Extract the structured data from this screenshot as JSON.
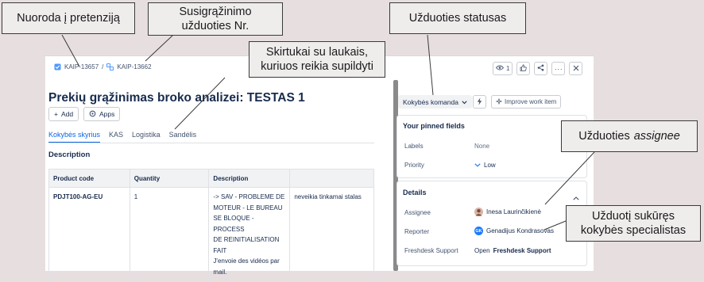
{
  "breadcrumb": {
    "parent_key": "KAIP-13657",
    "separator": "/",
    "current_key": "KAIP-13662"
  },
  "issue": {
    "title": "Prekių grąžinimas broko analizei: TESTAS 1"
  },
  "toolbar": {
    "add_label": "Add",
    "apps_label": "Apps"
  },
  "tabs": [
    {
      "label": "Kokybės skyrius",
      "active": true
    },
    {
      "label": "KAS",
      "active": false
    },
    {
      "label": "Logistika",
      "active": false
    },
    {
      "label": "Sandėlis",
      "active": false
    }
  ],
  "description": {
    "heading": "Description",
    "columns": [
      "Product code",
      "Quantity",
      "Description",
      ""
    ],
    "rows": [
      {
        "product_code": "PDJT100-AG-EU",
        "quantity": "1",
        "desc_lines": [
          "-> SAV - PROBLEME DE",
          "MOTEUR - LE BUREAU",
          "SE BLOQUE - PROCESS",
          "DE REINITIALISATION",
          "FAIT",
          "J'envoie des vidéos par",
          "mail."
        ],
        "note": "neveikia tinkamai stalas"
      }
    ]
  },
  "top_actions": {
    "watch_count": "1"
  },
  "status": {
    "label": "Kokybės komanda",
    "improve_label": "Improve work item"
  },
  "pinned": {
    "heading": "Your pinned fields",
    "labels_label": "Labels",
    "labels_value": "None",
    "priority_label": "Priority",
    "priority_value": "Low"
  },
  "details": {
    "heading": "Details",
    "assignee_label": "Assignee",
    "assignee_value": "Inesa Laurinčikienė",
    "reporter_label": "Reporter",
    "reporter_value": "Genadijus Kondrasovas",
    "reporter_initials": "GK",
    "freshdesk_label": "Freshdesk Support",
    "freshdesk_prefix": "Open",
    "freshdesk_value": "Freshdesk Support"
  },
  "callouts": {
    "link": "Nuoroda į pretenziją",
    "number_line1": "Susigrąžinimo",
    "number_line2": "užduoties Nr.",
    "status": "Užduoties statusas",
    "tabs_line1": "Skirtukai su laukais,",
    "tabs_line2": "kuriuos reikia supildyti",
    "assignee_prefix": "Užduoties",
    "assignee_em": "assignee",
    "reporter_line1": "Užduotį sukūręs",
    "reporter_line2": "kokybės specialistas"
  },
  "colors": {
    "accent": "#0c66e4",
    "reporter_avatar": "#1d7afc",
    "background": "#e7dfdf"
  }
}
